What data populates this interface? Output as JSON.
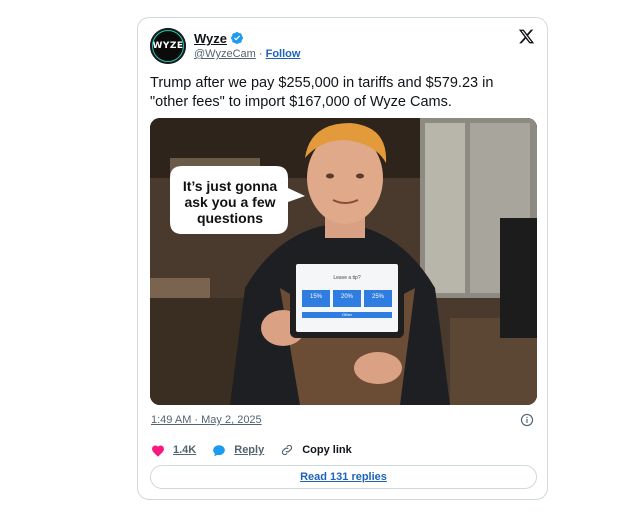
{
  "header": {
    "name": "Wyze",
    "handle": "@WyzeCam",
    "separator": "·",
    "follow_label": "Follow",
    "avatar_text": "WYZE"
  },
  "tweet": {
    "text": "Trump after we pay $255,000 in tariffs and $579.23 in \"other fees\" to import $167,000 of Wyze Cams."
  },
  "image": {
    "speech_bubble": "It’s just gonna ask you a few questions",
    "tablet_prompt": "Leave a tip?",
    "tablet_options": [
      "15%",
      "20%",
      "25%"
    ],
    "tablet_footer": "Other"
  },
  "meta": {
    "timestamp": "1:49 AM · May 2, 2025"
  },
  "actions": {
    "likes": "1.4K",
    "reply_label": "Reply",
    "copy_link_label": "Copy link"
  },
  "footer": {
    "read_replies_label": "Read 131 replies"
  },
  "colors": {
    "link_blue": "#1d64b8",
    "like_pink": "#f91880",
    "reply_blue": "#1d9bf0",
    "verified_blue": "#1d9bf0"
  }
}
